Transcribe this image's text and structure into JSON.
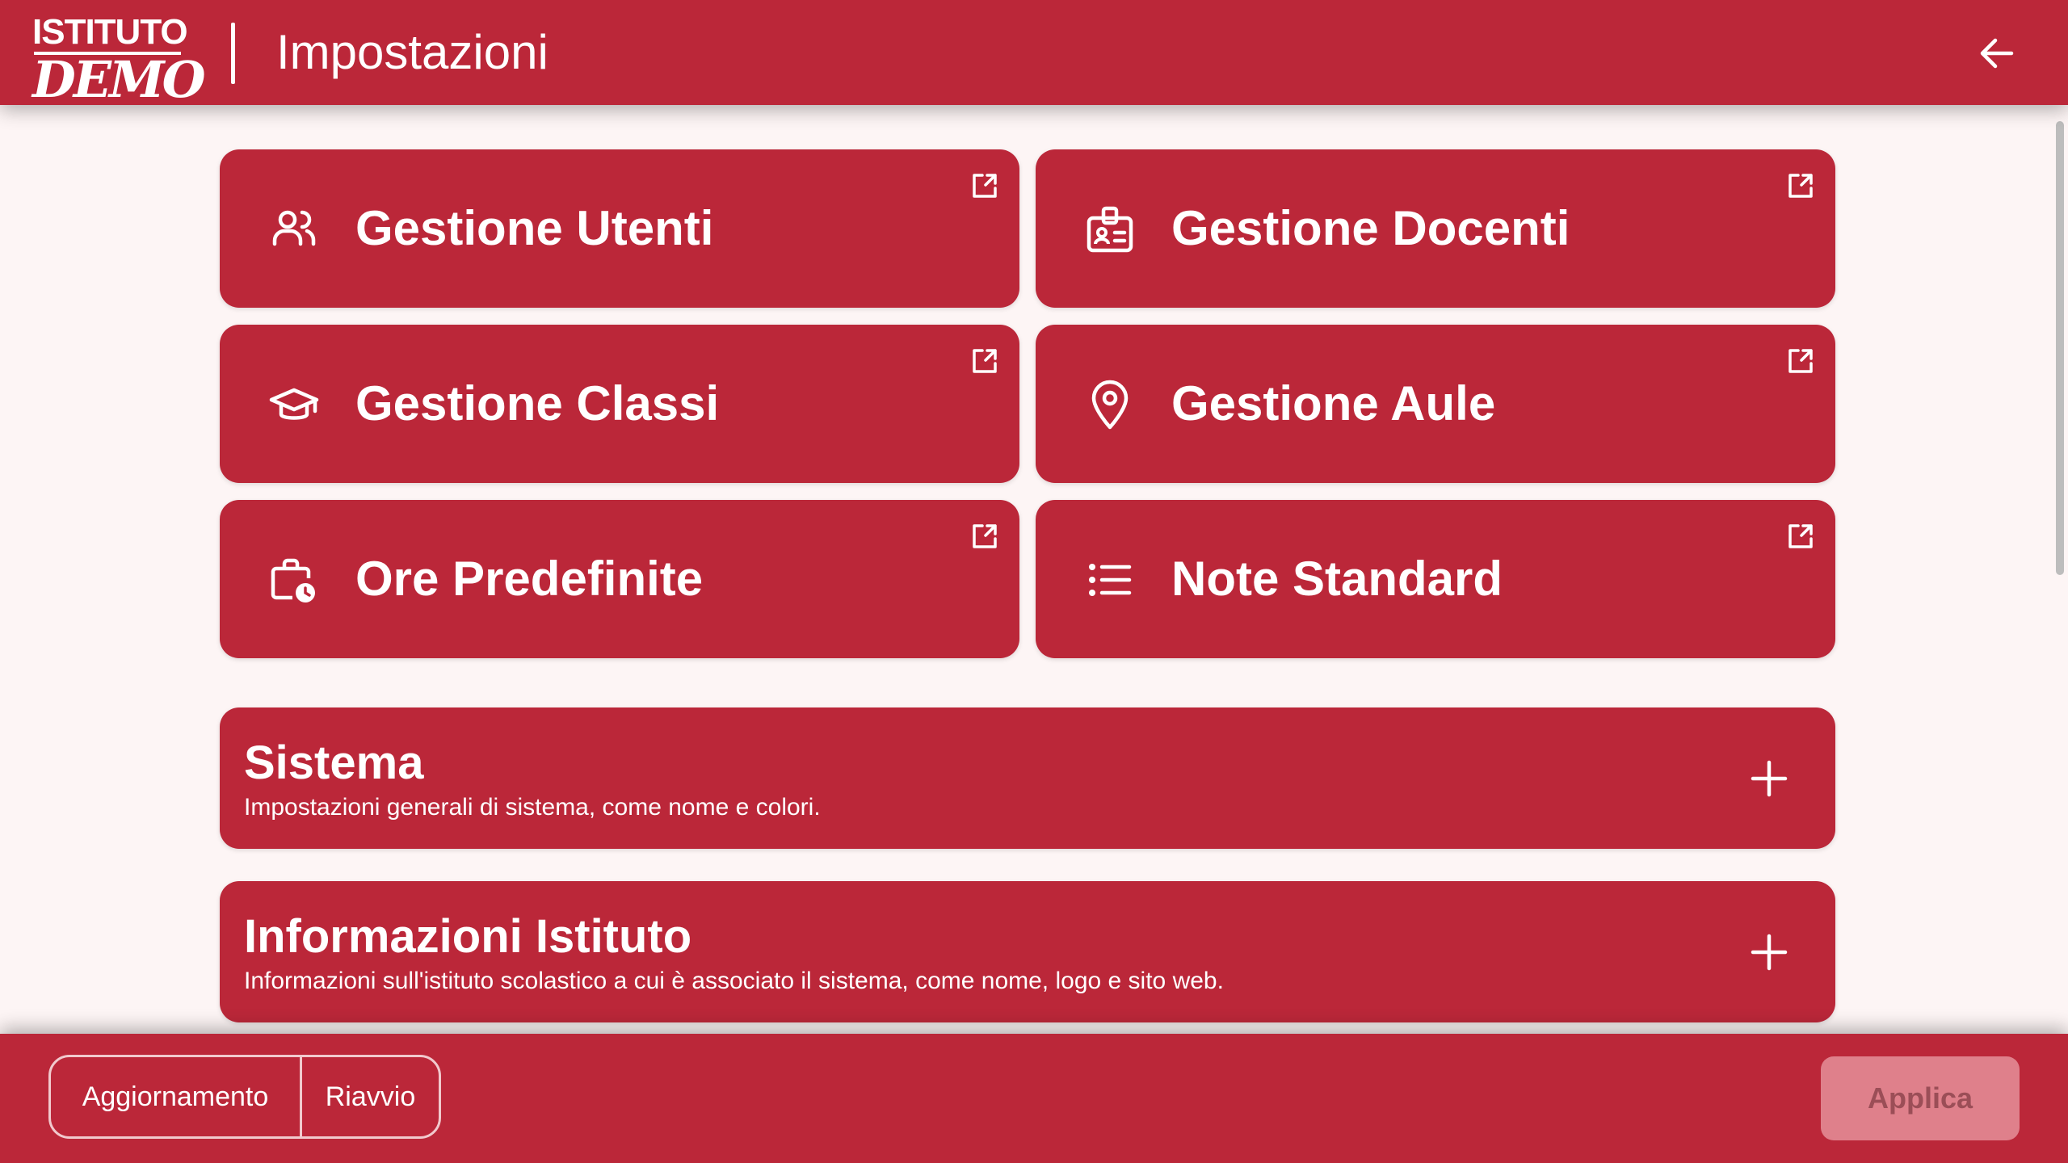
{
  "header": {
    "logo_top": "ISTITUTO",
    "logo_bottom": "DEMO",
    "title": "Impostazioni",
    "back_icon": "arrow-left-icon"
  },
  "tiles": [
    {
      "label": "Gestione Utenti",
      "icon": "users-icon",
      "link_icon": "external-link-icon"
    },
    {
      "label": "Gestione Docenti",
      "icon": "id-badge-icon",
      "link_icon": "external-link-icon"
    },
    {
      "label": "Gestione Classi",
      "icon": "graduation-cap-icon",
      "link_icon": "external-link-icon"
    },
    {
      "label": "Gestione Aule",
      "icon": "map-pin-icon",
      "link_icon": "external-link-icon"
    },
    {
      "label": "Ore Predefinite",
      "icon": "briefcase-clock-icon",
      "link_icon": "external-link-icon"
    },
    {
      "label": "Note Standard",
      "icon": "list-icon",
      "link_icon": "external-link-icon"
    }
  ],
  "sections": [
    {
      "title": "Sistema",
      "description": "Impostazioni generali di sistema, come nome e colori.",
      "expand_icon": "plus-icon"
    },
    {
      "title": "Informazioni Istituto",
      "description": "Informazioni sull'istituto scolastico a cui è associato il sistema, come nome, logo e sito web.",
      "expand_icon": "plus-icon"
    }
  ],
  "footer": {
    "update_label": "Aggiornamento",
    "restart_label": "Riavvio",
    "apply_label": "Applica"
  },
  "colors": {
    "primary": "#bb2739",
    "background": "#fdf5f5",
    "apply_disabled_bg": "#df808b",
    "apply_disabled_text": "#9b4e57"
  }
}
